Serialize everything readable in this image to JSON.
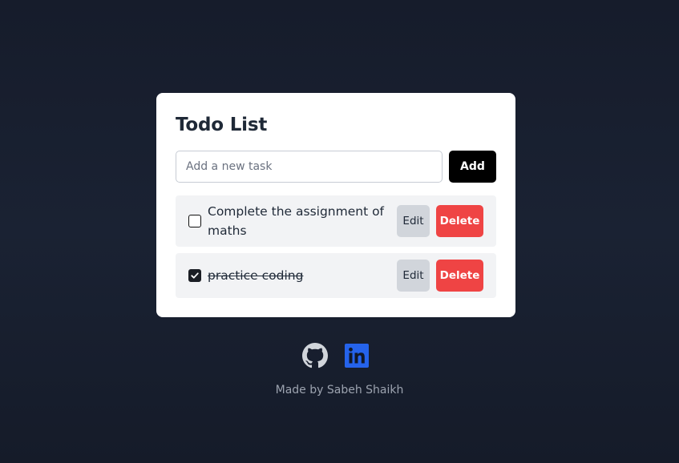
{
  "app": {
    "title": "Todo List"
  },
  "add_form": {
    "placeholder": "Add a new task",
    "value": "",
    "add_label": "Add"
  },
  "todos": [
    {
      "text": "Complete the assignment of maths",
      "completed": false,
      "edit_label": "Edit",
      "delete_label": "Delete"
    },
    {
      "text": "practice coding",
      "completed": true,
      "edit_label": "Edit",
      "delete_label": "Delete"
    }
  ],
  "social": {
    "github_icon": "github-icon",
    "linkedin_icon": "linkedin-icon"
  },
  "footer": {
    "text": "Made by Sabeh Shaikh"
  },
  "colors": {
    "background": "#171d2c",
    "card": "#ffffff",
    "add_button": "#000000",
    "edit_button": "#d1d5db",
    "delete_button": "#ef4444",
    "item_background": "#f2f3f5",
    "linkedin": "#2563eb",
    "github": "#d1d5db"
  }
}
